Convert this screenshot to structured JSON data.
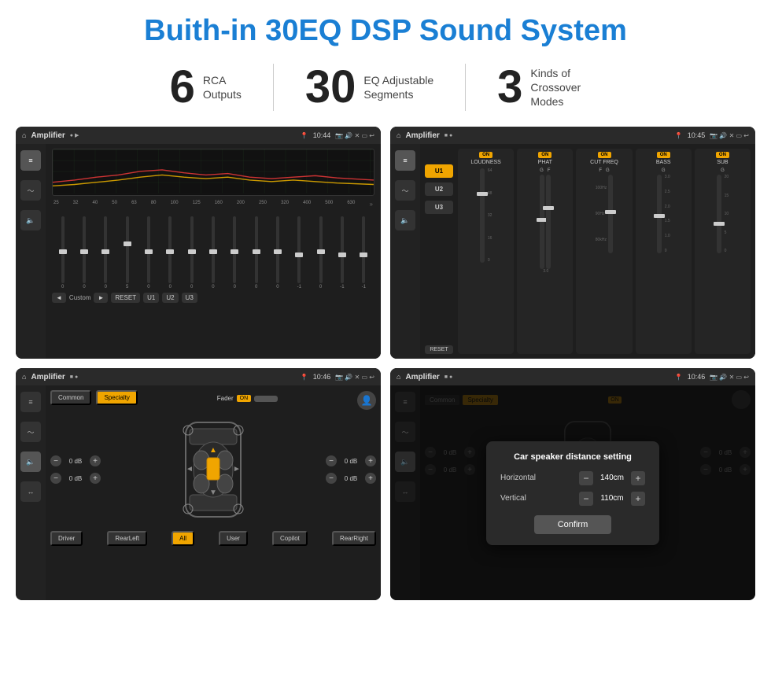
{
  "page": {
    "title": "Buith-in 30EQ DSP Sound System",
    "stats": [
      {
        "number": "6",
        "label": "RCA\nOutputs"
      },
      {
        "number": "30",
        "label": "EQ Adjustable\nSegments"
      },
      {
        "number": "3",
        "label": "Kinds of\nCrossover Modes"
      }
    ]
  },
  "screens": {
    "screen1": {
      "topbar": {
        "title": "Amplifier",
        "time": "10:44"
      },
      "eq_freqs": [
        "25",
        "32",
        "40",
        "50",
        "63",
        "80",
        "100",
        "125",
        "160",
        "200",
        "250",
        "320",
        "400",
        "500",
        "630"
      ],
      "eq_values": [
        "0",
        "0",
        "0",
        "5",
        "0",
        "0",
        "0",
        "0",
        "0",
        "0",
        "0",
        "-1",
        "0",
        "-1"
      ],
      "eq_preset": "Custom",
      "buttons": [
        "RESET",
        "U1",
        "U2",
        "U3"
      ]
    },
    "screen2": {
      "topbar": {
        "title": "Amplifier",
        "time": "10:45"
      },
      "presets": [
        "U1",
        "U2",
        "U3"
      ],
      "channels": [
        {
          "name": "LOUDNESS",
          "on": true
        },
        {
          "name": "PHAT",
          "on": true
        },
        {
          "name": "CUT FREQ",
          "on": true
        },
        {
          "name": "BASS",
          "on": true
        },
        {
          "name": "SUB",
          "on": true
        }
      ],
      "reset_label": "RESET"
    },
    "screen3": {
      "topbar": {
        "title": "Amplifier",
        "time": "10:46"
      },
      "tabs": [
        "Common",
        "Specialty"
      ],
      "active_tab": "Specialty",
      "fader_label": "Fader",
      "fader_on": "ON",
      "db_controls": [
        "0 dB",
        "0 dB",
        "0 dB",
        "0 dB"
      ],
      "bottom_btns": [
        "Driver",
        "RearLeft",
        "All",
        "User",
        "Copilot",
        "RearRight"
      ]
    },
    "screen4": {
      "topbar": {
        "title": "Amplifier",
        "time": "10:46"
      },
      "tabs": [
        "Common",
        "Specialty"
      ],
      "dialog": {
        "title": "Car speaker distance setting",
        "rows": [
          {
            "label": "Horizontal",
            "value": "140cm"
          },
          {
            "label": "Vertical",
            "value": "110cm"
          }
        ],
        "confirm_label": "Confirm"
      },
      "right_controls": [
        "0 dB",
        "0 dB"
      ],
      "bottom_btns": [
        "Driver",
        "RearLeft...",
        "All",
        "User",
        "Copilot",
        "RearRight"
      ]
    }
  }
}
